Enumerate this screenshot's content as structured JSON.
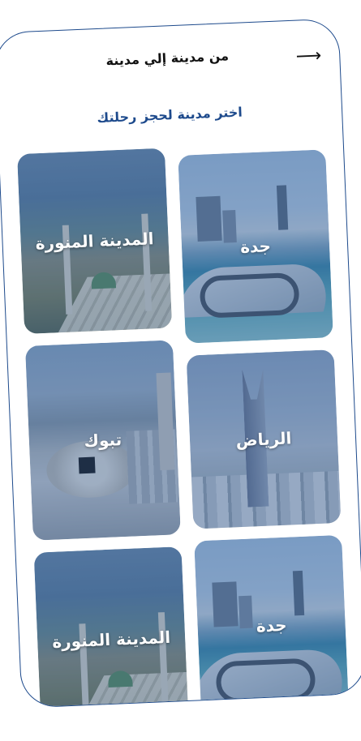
{
  "header": {
    "title": "من مدينة إلي مدينة",
    "back_icon": "arrow-right-icon",
    "back_glyph": "⟶"
  },
  "subtitle": "اختر مدينة لحجز رحلتك",
  "colors": {
    "accent": "#1d4a8c",
    "title": "#111111"
  },
  "cities": [
    {
      "label": "جدة",
      "image": "jeddah-image"
    },
    {
      "label": "المدينة المنورة",
      "image": "madinah-image"
    },
    {
      "label": "الرياض",
      "image": "riyadh-image"
    },
    {
      "label": "تبوك",
      "image": "tabuk-image"
    },
    {
      "label": "جدة",
      "image": "jeddah-image"
    },
    {
      "label": "المدينة المنورة",
      "image": "madinah-image"
    }
  ]
}
